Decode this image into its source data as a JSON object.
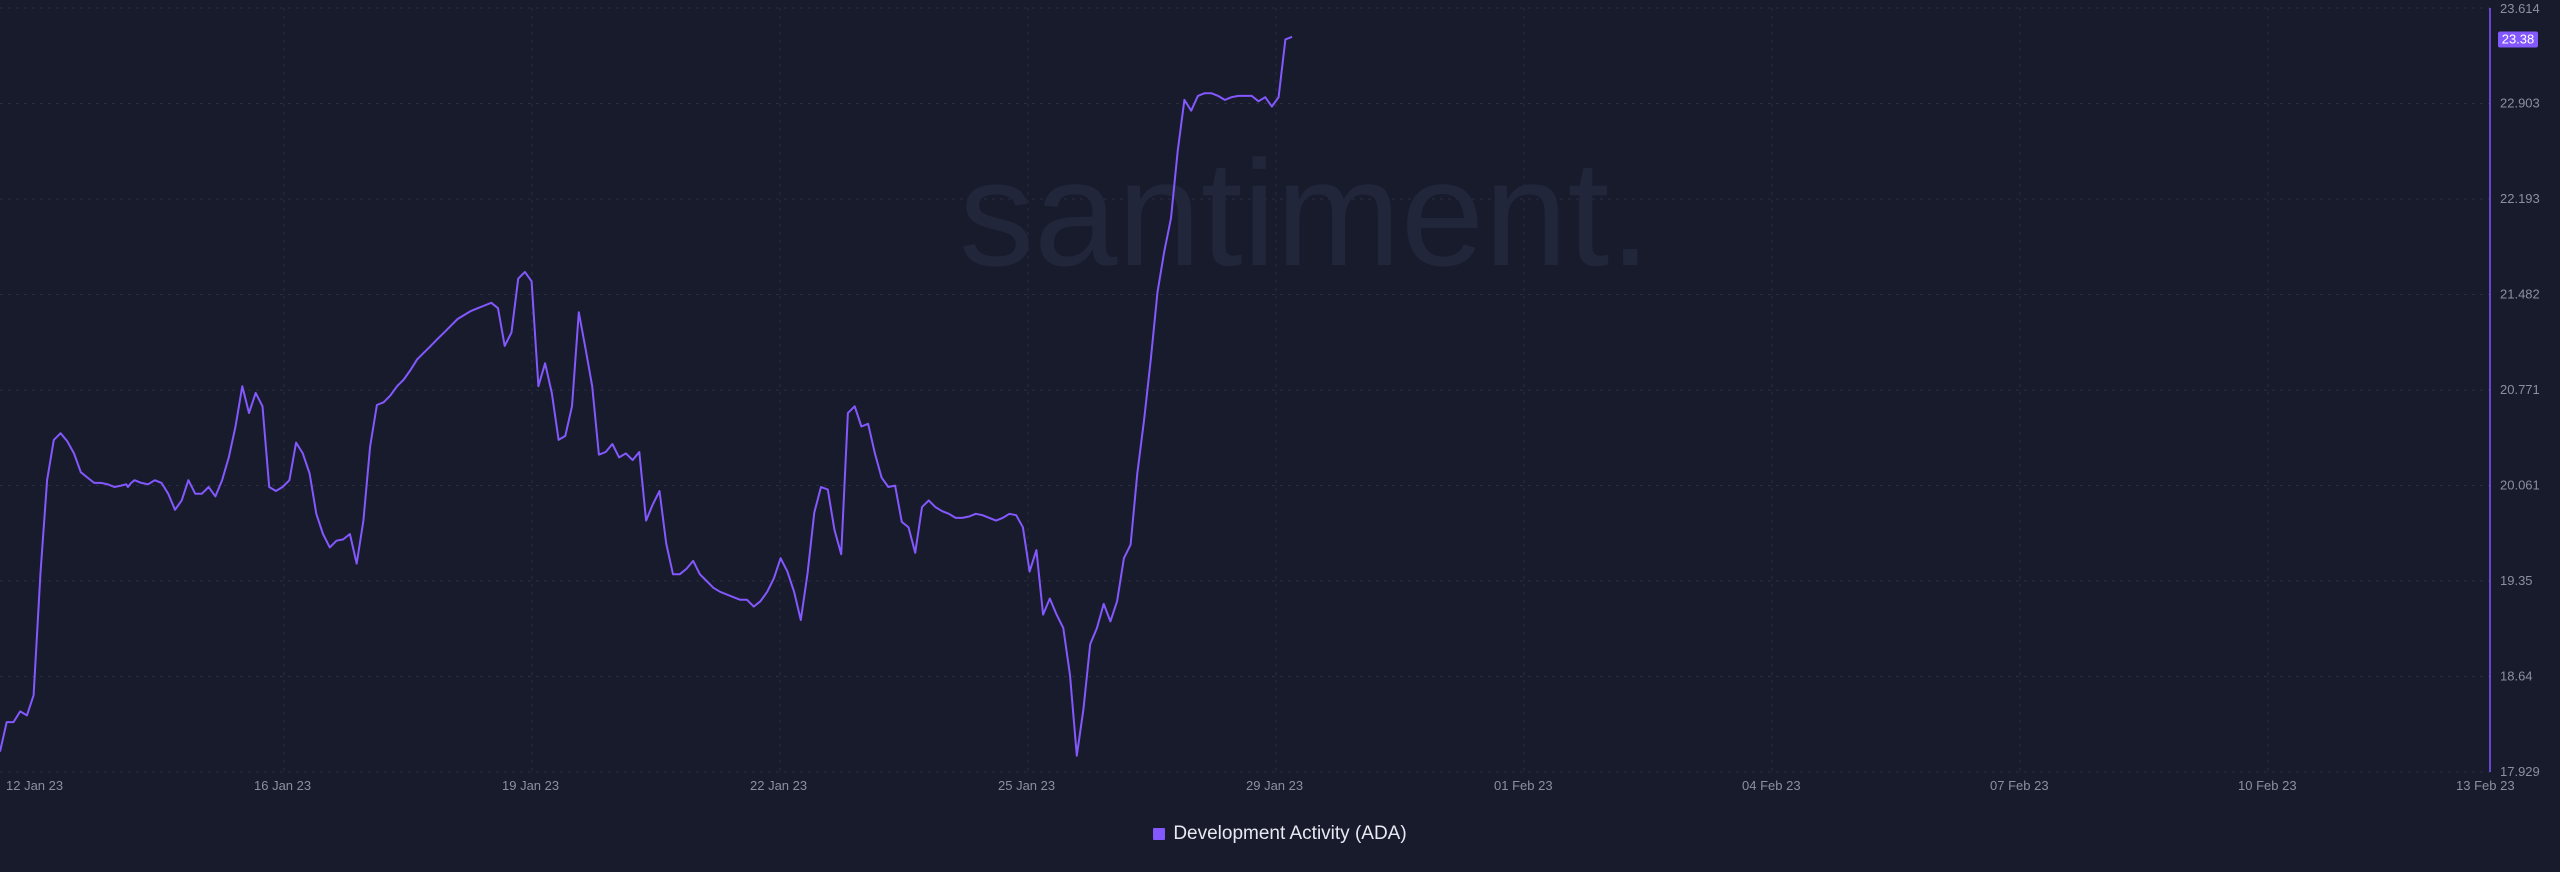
{
  "chart_data": {
    "type": "line",
    "title": "",
    "xlabel": "",
    "ylabel": "",
    "watermark": "santiment.",
    "x_ticks": [
      "12 Jan 23",
      "16 Jan 23",
      "19 Jan 23",
      "22 Jan 23",
      "25 Jan 23",
      "29 Jan 23",
      "01 Feb 23",
      "04 Feb 23",
      "07 Feb 23",
      "10 Feb 23",
      "13 Feb 23"
    ],
    "y_ticks": [
      "17.929",
      "18.64",
      "19.35",
      "20.061",
      "20.771",
      "21.482",
      "22.193",
      "22.903",
      "23.614"
    ],
    "ylim": [
      17.929,
      23.614
    ],
    "grid": true,
    "legend_position": "bottom-center",
    "current_value_label": "23.38",
    "colors": {
      "background": "#181b2b",
      "line": "#8358ff",
      "grid": "#2a2e40",
      "axis_text": "#8a8fa3"
    },
    "series": [
      {
        "name": "Development Activity (ADA)",
        "x_index": [
          0,
          2,
          4,
          6,
          8,
          10,
          12,
          14,
          16,
          18,
          20,
          22,
          24,
          26,
          28,
          30,
          32,
          34,
          36,
          37.5,
          38,
          39,
          40,
          42,
          44,
          46,
          48,
          50,
          52,
          54,
          56,
          58,
          60,
          62,
          64,
          66,
          68,
          70,
          72,
          74,
          76,
          78,
          80,
          82,
          84,
          86,
          88,
          90,
          92,
          94,
          96,
          98,
          100,
          102,
          104,
          106,
          108,
          110,
          112,
          114,
          116,
          118,
          120,
          122,
          124,
          126,
          128,
          130,
          132,
          134,
          136,
          138,
          140,
          142,
          144,
          146,
          148,
          150,
          152,
          154,
          156,
          158,
          160,
          162,
          164,
          166,
          168,
          170,
          172,
          174,
          176,
          178,
          180,
          182,
          184,
          186,
          188,
          190,
          192,
          194,
          196,
          198,
          200,
          202,
          204,
          206,
          208,
          210,
          212,
          214,
          216,
          218,
          220,
          222,
          224,
          226,
          228,
          230,
          232,
          234,
          236,
          238,
          240,
          242,
          244,
          246,
          248,
          250,
          252,
          254,
          256,
          258,
          260,
          262,
          264,
          266,
          268,
          270,
          272,
          274,
          276,
          278,
          280,
          282,
          284,
          286,
          288,
          290,
          292,
          294,
          296,
          298,
          300,
          302,
          304,
          306,
          308,
          310,
          312,
          314,
          316,
          318,
          320,
          322,
          324,
          326,
          328,
          330,
          332,
          334,
          336,
          338,
          340,
          342,
          344,
          346,
          348,
          350,
          352,
          354,
          356,
          358,
          360,
          362,
          364,
          366,
          368,
          370,
          372,
          374,
          376,
          378,
          380,
          382,
          384,
          386,
          388,
          390,
          392,
          394,
          396,
          398,
          400,
          402,
          404,
          406,
          408,
          410,
          412,
          414,
          416,
          418,
          420,
          422,
          424,
          426,
          428,
          430,
          432,
          434,
          436,
          438,
          440,
          442,
          444,
          446,
          448,
          450,
          452,
          454,
          456,
          458,
          460,
          462,
          464,
          466,
          468,
          470,
          472,
          474,
          476,
          478,
          480,
          482,
          484,
          486,
          488,
          490,
          492,
          494,
          496,
          498,
          500,
          502,
          504,
          506,
          508,
          510,
          512,
          514,
          516,
          518,
          520,
          522,
          524,
          526,
          528,
          530,
          532,
          534,
          536,
          538,
          540,
          542,
          544,
          546,
          548,
          550,
          552,
          554,
          556,
          558,
          560,
          562,
          564,
          566,
          568,
          570,
          572,
          574,
          576,
          578,
          580,
          582,
          584,
          586,
          588,
          590,
          592,
          594,
          596,
          598,
          600,
          602,
          604,
          606,
          608,
          610,
          612,
          614,
          616,
          618,
          620,
          622,
          624,
          626,
          628,
          630,
          632,
          634,
          636,
          638,
          640,
          642,
          644,
          646,
          648,
          650,
          652,
          654,
          656,
          658,
          660,
          662,
          664,
          666,
          668,
          670,
          672,
          674,
          676,
          678,
          680,
          682,
          684,
          686,
          688,
          690,
          692,
          694,
          696,
          698,
          700,
          702,
          704,
          706,
          708,
          710,
          712,
          714,
          716,
          718,
          720,
          722,
          724,
          726,
          728,
          730,
          732,
          734,
          736,
          738,
          740
        ],
        "values": [
          18.08,
          18.3,
          18.3,
          18.38,
          18.35,
          18.5,
          19.4,
          20.1,
          20.4,
          20.45,
          20.39,
          20.3,
          20.16,
          20.12,
          20.08,
          20.08,
          20.07,
          20.05,
          20.06,
          20.07,
          20.05,
          20.08,
          20.1,
          20.08,
          20.07,
          20.1,
          20.08,
          20.0,
          19.88,
          19.95,
          20.1,
          20.0,
          20.0,
          20.05,
          19.98,
          20.1,
          20.27,
          20.5,
          20.8,
          20.6,
          20.75,
          20.65,
          20.05,
          20.02,
          20.05,
          20.1,
          20.38,
          20.3,
          20.15,
          19.85,
          19.7,
          19.6,
          19.65,
          19.66,
          19.7,
          19.48,
          19.8,
          20.35,
          20.66,
          20.68,
          20.73,
          20.8,
          20.85,
          20.92,
          21.0,
          21.05,
          21.1,
          21.15,
          21.2,
          21.25,
          21.3,
          21.33,
          21.36,
          21.38,
          21.4,
          21.42,
          21.38,
          21.1,
          21.2,
          21.6,
          21.65,
          21.58,
          20.8,
          20.97,
          20.75,
          20.4,
          20.43,
          20.65,
          21.35,
          21.08,
          20.8,
          20.29,
          20.31,
          20.37,
          20.27,
          20.3,
          20.25,
          20.31,
          19.8,
          19.92,
          20.02,
          19.63,
          19.4,
          19.4,
          19.44,
          19.5,
          19.4,
          19.35,
          19.3,
          19.27,
          19.25,
          19.23,
          19.21,
          19.21,
          19.16,
          19.2,
          19.27,
          19.37,
          19.52,
          19.42,
          19.27,
          19.06,
          19.41,
          19.86,
          20.05,
          20.03,
          19.73,
          19.55,
          20.6,
          20.65,
          20.5,
          20.52,
          20.3,
          20.12,
          20.05,
          20.06,
          19.79,
          19.75,
          19.56,
          19.9,
          19.95,
          19.9,
          19.87,
          19.85,
          19.82,
          19.82,
          19.83,
          19.85,
          19.84,
          19.82,
          19.8,
          19.82,
          19.85,
          19.84,
          19.75,
          19.42,
          19.58,
          19.1,
          19.22,
          19.1,
          19.0,
          18.65,
          18.05,
          18.4,
          18.88,
          19.0,
          19.18,
          19.05,
          19.2,
          19.52,
          19.62,
          20.15,
          20.55,
          21.0,
          21.5,
          21.8,
          22.05,
          22.55,
          22.93,
          22.85,
          22.96,
          22.98,
          22.98,
          22.96,
          22.93,
          22.95,
          22.96,
          22.96,
          22.96,
          22.92,
          22.95,
          22.88,
          22.95,
          23.38,
          23.4
        ]
      }
    ]
  }
}
